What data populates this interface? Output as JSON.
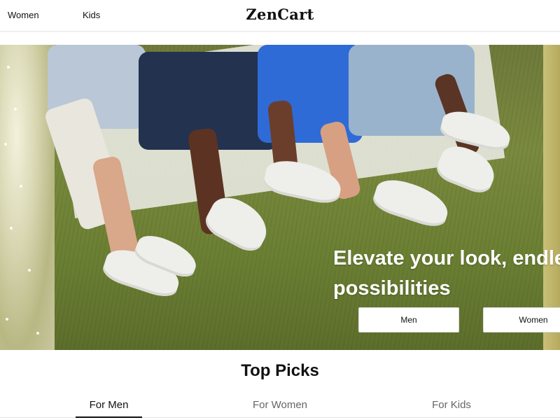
{
  "header": {
    "brand": "ZenCart",
    "nav": {
      "women_label": "Women",
      "kids_label": "Kids"
    }
  },
  "hero": {
    "headline_line1": "Elevate your look, endle",
    "headline_line2": "possibilities",
    "buttons": {
      "men_label": "Men",
      "women_label": "Women"
    }
  },
  "top_picks": {
    "title": "Top Picks",
    "tabs": [
      {
        "label": "For Men",
        "active": true
      },
      {
        "label": "For Women",
        "active": false
      },
      {
        "label": "For Kids",
        "active": false
      }
    ]
  }
}
